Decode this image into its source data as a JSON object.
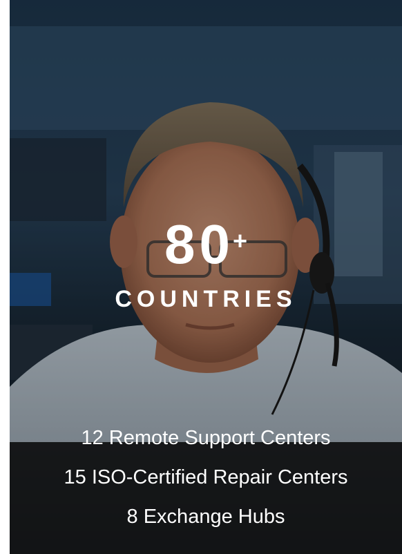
{
  "stat": {
    "number": "80",
    "suffix": "+",
    "label": "COUNTRIES"
  },
  "facts": [
    "12 Remote Support Centers",
    "15 ISO-Certified Repair Centers",
    "8 Exchange Hubs"
  ],
  "colors": {
    "text": "#ffffff",
    "overlay": "#000000"
  }
}
